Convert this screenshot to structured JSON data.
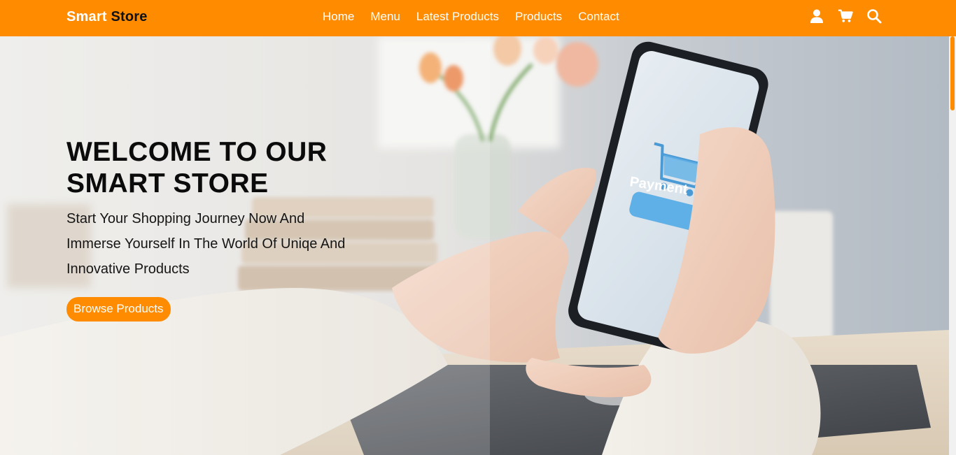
{
  "header": {
    "brand_part1": "Smart",
    "brand_part2": " Store",
    "nav": [
      {
        "label": "Home"
      },
      {
        "label": "Menu"
      },
      {
        "label": "Latest Products"
      },
      {
        "label": "Products"
      },
      {
        "label": "Contact"
      }
    ],
    "icons": [
      "user-icon",
      "cart-icon",
      "search-icon"
    ]
  },
  "hero": {
    "title_line1": "WELCOME TO OUR",
    "title_line2": "SMART STORE",
    "subtitle": "Start Your Shopping Journey Now And Immerse Yourself In The World Of Uniqe And Innovative Products",
    "button_label": "Browse Products",
    "phone_screen_label": "Payment"
  },
  "colors": {
    "accent": "#ff8c00",
    "title": "#0b0b0b",
    "nav_text": "#ffffff"
  }
}
